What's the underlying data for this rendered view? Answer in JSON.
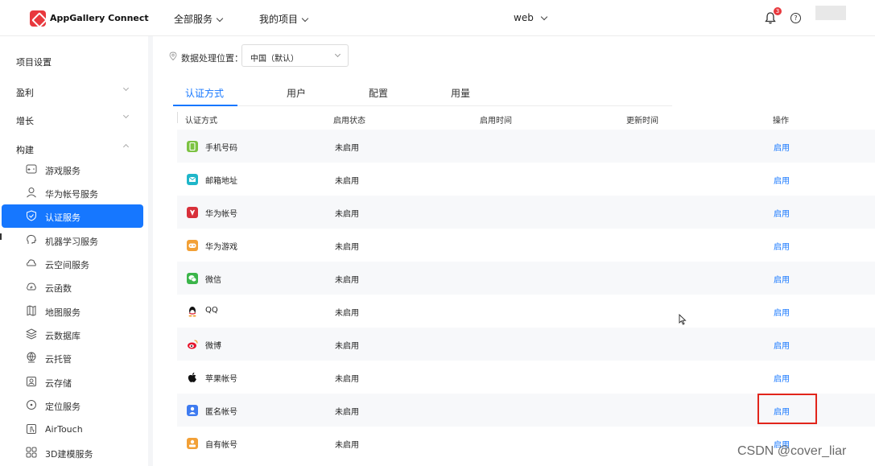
{
  "topbar": {
    "brand": "AppGallery Connect",
    "nav": [
      {
        "label": "全部服务"
      },
      {
        "label": "我的项目"
      },
      {
        "label": "web"
      }
    ],
    "notification_count": "3",
    "help_glyph": "?"
  },
  "sidebar": {
    "sections": [
      {
        "label": "项目设置"
      },
      {
        "label": "盈利"
      },
      {
        "label": "增长"
      },
      {
        "label": "构建"
      }
    ],
    "items": [
      {
        "label": "游戏服务",
        "icon": "gamepad-icon"
      },
      {
        "label": "华为帐号服务",
        "icon": "user-icon"
      },
      {
        "label": "认证服务",
        "icon": "shield-check-icon",
        "active": true
      },
      {
        "label": "机器学习服务",
        "icon": "head-icon"
      },
      {
        "label": "云空间服务",
        "icon": "cloud-space-icon"
      },
      {
        "label": "云函数",
        "icon": "cloud-function-icon"
      },
      {
        "label": "地图服务",
        "icon": "map-icon"
      },
      {
        "label": "云数据库",
        "icon": "database-icon"
      },
      {
        "label": "云托管",
        "icon": "globe-icon"
      },
      {
        "label": "云存储",
        "icon": "storage-icon"
      },
      {
        "label": "定位服务",
        "icon": "locate-icon"
      },
      {
        "label": "AirTouch",
        "icon": "touch-icon"
      },
      {
        "label": "3D建模服务",
        "icon": "grid-icon"
      }
    ]
  },
  "main": {
    "location_label": "数据处理位置：",
    "location_value": "中国（默认）",
    "tabs": [
      {
        "label": "认证方式",
        "active": true
      },
      {
        "label": "用户"
      },
      {
        "label": "配置"
      },
      {
        "label": "用量"
      }
    ],
    "columns": [
      "认证方式",
      "启用状态",
      "启用时间",
      "更新时间",
      "操作"
    ],
    "rows": [
      {
        "name": "手机号码",
        "status": "未启用",
        "action": "启用",
        "icon": "phone-icon",
        "color": "#7cc242"
      },
      {
        "name": "邮箱地址",
        "status": "未启用",
        "action": "启用",
        "icon": "mail-icon",
        "color": "#1fb6c9"
      },
      {
        "name": "华为帐号",
        "status": "未启用",
        "action": "启用",
        "icon": "huawei-icon",
        "color": "#d8303a"
      },
      {
        "name": "华为游戏",
        "status": "未启用",
        "action": "启用",
        "icon": "game-icon",
        "color": "#f2a036"
      },
      {
        "name": "微信",
        "status": "未启用",
        "action": "启用",
        "icon": "wechat-icon",
        "color": "#3bb54a"
      },
      {
        "name": "QQ",
        "status": "未启用",
        "action": "启用",
        "icon": "qq-icon",
        "color": "#111111"
      },
      {
        "name": "微博",
        "status": "未启用",
        "action": "启用",
        "icon": "weibo-icon",
        "color": "#e6162d"
      },
      {
        "name": "苹果帐号",
        "status": "未启用",
        "action": "启用",
        "icon": "apple-icon",
        "color": "#111111"
      },
      {
        "name": "匿名帐号",
        "status": "未启用",
        "action": "启用",
        "icon": "anonymous-icon",
        "color": "#3e7bf0"
      },
      {
        "name": "自有帐号",
        "status": "未启用",
        "action": "启用",
        "icon": "own-account-icon",
        "color": "#f2a036"
      }
    ]
  },
  "watermark": "CSDN @cover_liar"
}
